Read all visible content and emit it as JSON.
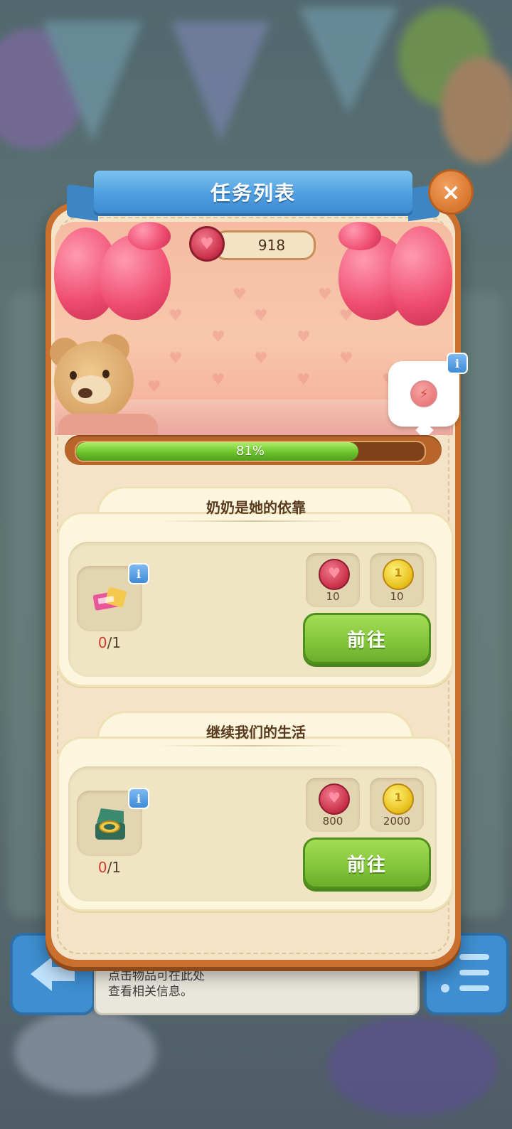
{
  "modal": {
    "title": "任务列表",
    "close_label": "×"
  },
  "currency": {
    "icon": "heart-token-icon",
    "value": "918"
  },
  "progress": {
    "label": "81%",
    "fraction": 0.81
  },
  "bubble": {
    "icon": "lightning-icon",
    "info_label": "i"
  },
  "tasks": [
    {
      "title": "奶奶是她的依靠",
      "item_icon": "tickets-icon",
      "info_label": "i",
      "count_current": "0",
      "count_total": "/1",
      "rewards": [
        {
          "icon": "heart-token-icon",
          "value": "10"
        },
        {
          "icon": "coin-icon",
          "value": "10"
        }
      ],
      "button_label": "前往"
    },
    {
      "title": "继续我们的生活",
      "item_icon": "ring-box-icon",
      "info_label": "i",
      "count_current": "0",
      "count_total": "/1",
      "rewards": [
        {
          "icon": "heart-token-icon",
          "value": "800"
        },
        {
          "icon": "coin-icon",
          "value": "2000"
        }
      ],
      "button_label": "前往"
    }
  ],
  "background": {
    "hint_line1": "点击物品可在此处",
    "hint_line2": "查看相关信息。"
  },
  "colors": {
    "modal_frame": "#c9702f",
    "ribbon": "#4f9fe0",
    "go_button": "#82c43a",
    "progress_fill": "#6cc32c"
  }
}
